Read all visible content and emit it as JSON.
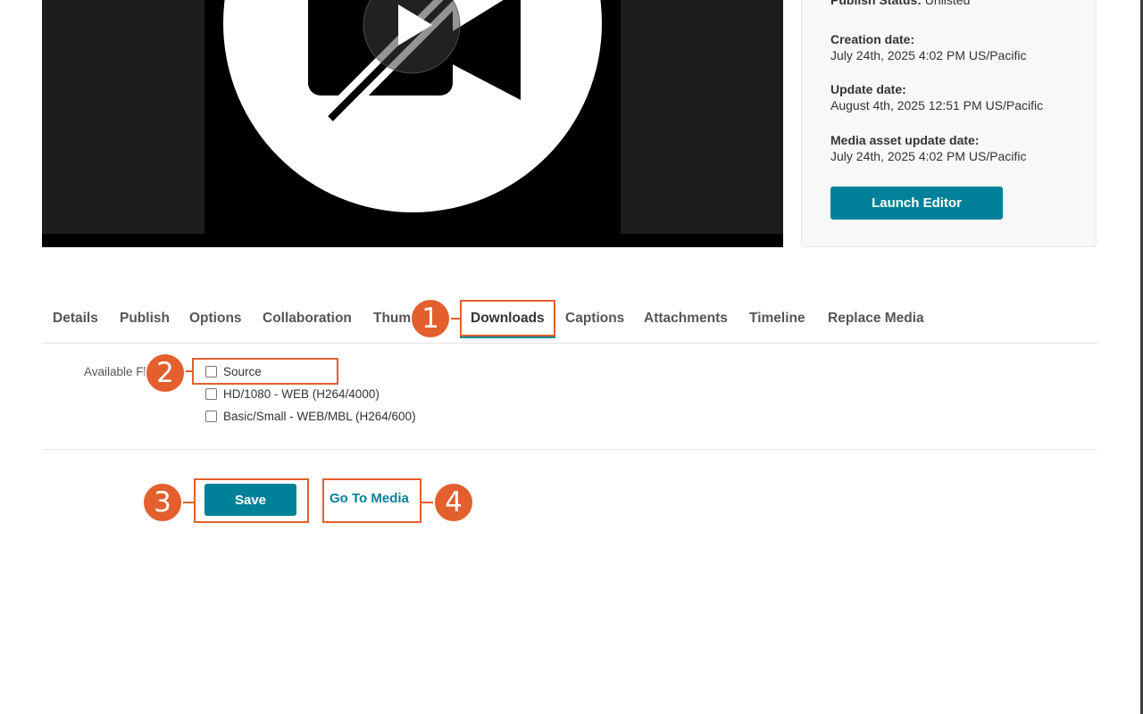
{
  "video": {
    "play_icon": "play-icon",
    "placeholder_icon": "video-off-icon"
  },
  "info": {
    "publish_status_label": "Publish Status:",
    "publish_status_value": "Unlisted",
    "creation_label": "Creation date:",
    "creation_value": "July 24th, 2025 4:02 PM US/Pacific",
    "update_label": "Update date:",
    "update_value": "August 4th, 2025 12:51 PM US/Pacific",
    "media_update_label": "Media asset update date:",
    "media_update_value": "July 24th, 2025 4:02 PM US/Pacific",
    "launch_editor_label": "Launch Editor"
  },
  "tabs": [
    {
      "label": "Details"
    },
    {
      "label": "Publish"
    },
    {
      "label": "Options"
    },
    {
      "label": "Collaboration"
    },
    {
      "label": "Thum"
    },
    {
      "label": "Downloads",
      "active": true
    },
    {
      "label": "Captions"
    },
    {
      "label": "Attachments"
    },
    {
      "label": "Timeline"
    },
    {
      "label": "Replace Media"
    }
  ],
  "downloads": {
    "available_label": "Available Fl",
    "options": [
      {
        "label": "Source",
        "checked": false
      },
      {
        "label": "HD/1080 - WEB (H264/4000)",
        "checked": false
      },
      {
        "label": "Basic/Small - WEB/MBL (H264/600)",
        "checked": false
      }
    ]
  },
  "actions": {
    "save_label": "Save",
    "goto_media_label": "Go To Media"
  },
  "annotations": {
    "badges": [
      "1",
      "2",
      "3",
      "4"
    ],
    "color": "#e35f2d"
  },
  "colors": {
    "accent": "#00819a"
  }
}
